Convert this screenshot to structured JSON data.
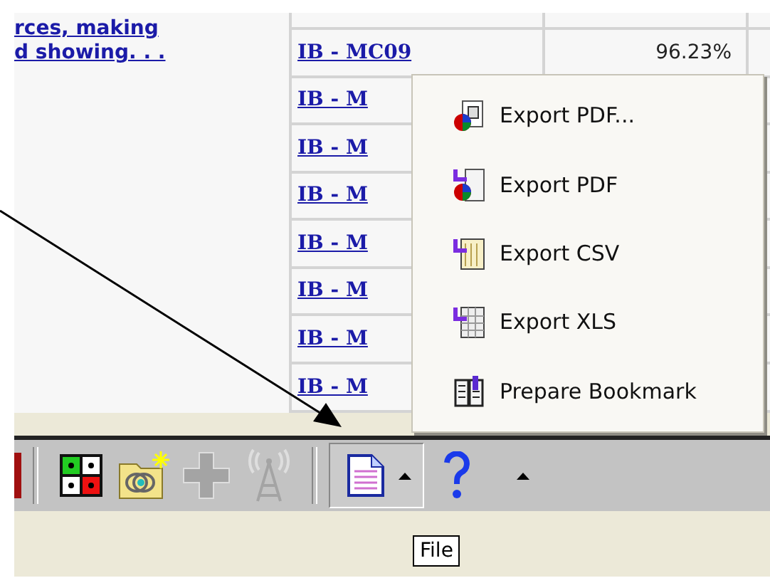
{
  "description_link": {
    "lines": [
      "rces, making",
      "d showing. . ."
    ]
  },
  "table": {
    "rows": [
      {
        "code": "IB - MC09",
        "value": "96.23%"
      },
      {
        "code": "IB - M",
        "value": ""
      },
      {
        "code": "IB - M",
        "value": ""
      },
      {
        "code": "IB - M",
        "value": ""
      },
      {
        "code": "IB - M",
        "value": ""
      },
      {
        "code": "IB - M",
        "value": ""
      },
      {
        "code": "IB - M",
        "value": ""
      },
      {
        "code": "IB - M",
        "value": ""
      }
    ]
  },
  "toolbar": {
    "items": [
      {
        "kind": "tool",
        "disabled": false
      },
      {
        "kind": "tool",
        "disabled": false
      },
      {
        "kind": "tool",
        "disabled": true
      },
      {
        "kind": "tool",
        "disabled": true
      },
      {
        "kind": "menu",
        "pressed": true
      },
      {
        "kind": "help",
        "pressed": false
      }
    ]
  },
  "menu": {
    "items": [
      {
        "label": "Export PDF..."
      },
      {
        "label": "Export PDF"
      },
      {
        "label": "Export CSV"
      },
      {
        "label": "Export XLS"
      },
      {
        "label": "Prepare Bookmark"
      }
    ]
  },
  "tooltip": {
    "text": "File"
  }
}
